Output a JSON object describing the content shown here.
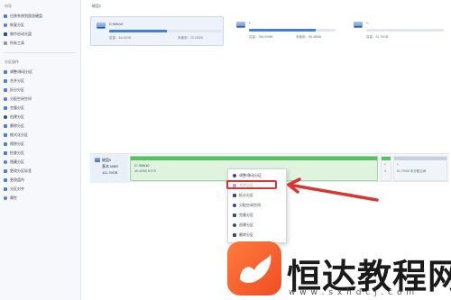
{
  "sidebar": {
    "section1_title": "向导",
    "wizard_items": [
      {
        "label": "迁移系统到固态硬盘",
        "icon": "migrate-icon"
      },
      {
        "label": "恢复分区",
        "icon": "restore-icon"
      },
      {
        "label": "制作启动光盘",
        "icon": "boot-disc-icon"
      },
      {
        "label": "所有工具",
        "icon": "tools-icon"
      }
    ],
    "section2_title": "分区操作",
    "partition_items": [
      {
        "label": "调整/移动分区",
        "icon": "resize-icon"
      },
      {
        "label": "合并分区",
        "icon": "merge-icon"
      },
      {
        "label": "拆分分区",
        "icon": "split-icon"
      },
      {
        "label": "分配空闲空间",
        "icon": "allocate-icon"
      },
      {
        "label": "克隆分区",
        "icon": "clone-icon"
      },
      {
        "label": "创建分区",
        "icon": "create-icon"
      },
      {
        "label": "删除分区",
        "icon": "delete-icon"
      },
      {
        "label": "格式化分区",
        "icon": "format-icon"
      },
      {
        "label": "擦除分区",
        "icon": "wipe-icon"
      },
      {
        "label": "检查分区",
        "icon": "check-icon"
      },
      {
        "label": "隐藏分区",
        "icon": "hide-icon"
      },
      {
        "label": "更改分区标签",
        "icon": "label-icon"
      },
      {
        "label": "更改盘符",
        "icon": "drive-letter-icon"
      },
      {
        "label": "分区对齐",
        "icon": "align-icon"
      },
      {
        "label": "属性",
        "icon": "properties-icon"
      }
    ]
  },
  "main": {
    "disk_title": "硬盘0",
    "cards": [
      {
        "name": "C:Win10",
        "capacity": "容量：46.43GB",
        "free": "未使用：22.29GB",
        "used_ratio": 0.52
      },
      {
        "name": "*:",
        "capacity": "容量：384.00MB",
        "free": "未使用：86.48MB",
        "used_ratio": 0.77
      },
      {
        "name": "*:",
        "capacity": "容量：61.79GB",
        "free": "",
        "used_ratio": 0.0
      }
    ],
    "disk": {
      "label": "硬盘0",
      "type": "基本 MBR",
      "size": "111.79GB",
      "segments": [
        {
          "name": "C: Win10",
          "size": "46.43GB NTFS"
        },
        {
          "name": "*:",
          "size": "3"
        },
        {
          "name": "*:",
          "size": "61.79GB 未分配空间"
        }
      ]
    }
  },
  "context_menu": {
    "items": [
      {
        "label": "调整/移动分区",
        "icon": "resize-icon"
      },
      {
        "label": "合并分区",
        "icon": "merge-icon"
      },
      {
        "label": "拆分分区",
        "icon": "split-icon"
      },
      {
        "label": "分配空闲空间",
        "icon": "allocate-icon"
      },
      {
        "label": "克隆分区",
        "icon": "clone-icon"
      },
      {
        "label": "创建分区",
        "icon": "create-icon"
      },
      {
        "label": "删除分区",
        "icon": "delete-icon"
      }
    ],
    "highlight_color": "#d9362f"
  },
  "watermark": {
    "name": "恒达教程网",
    "url": "w w w . s x h d c j . c o m"
  },
  "colors": {
    "accent": "#3f7fde",
    "partition_green": "#56c25c",
    "arrow_red": "#d9362f",
    "logo_orange": "#f04e23"
  }
}
